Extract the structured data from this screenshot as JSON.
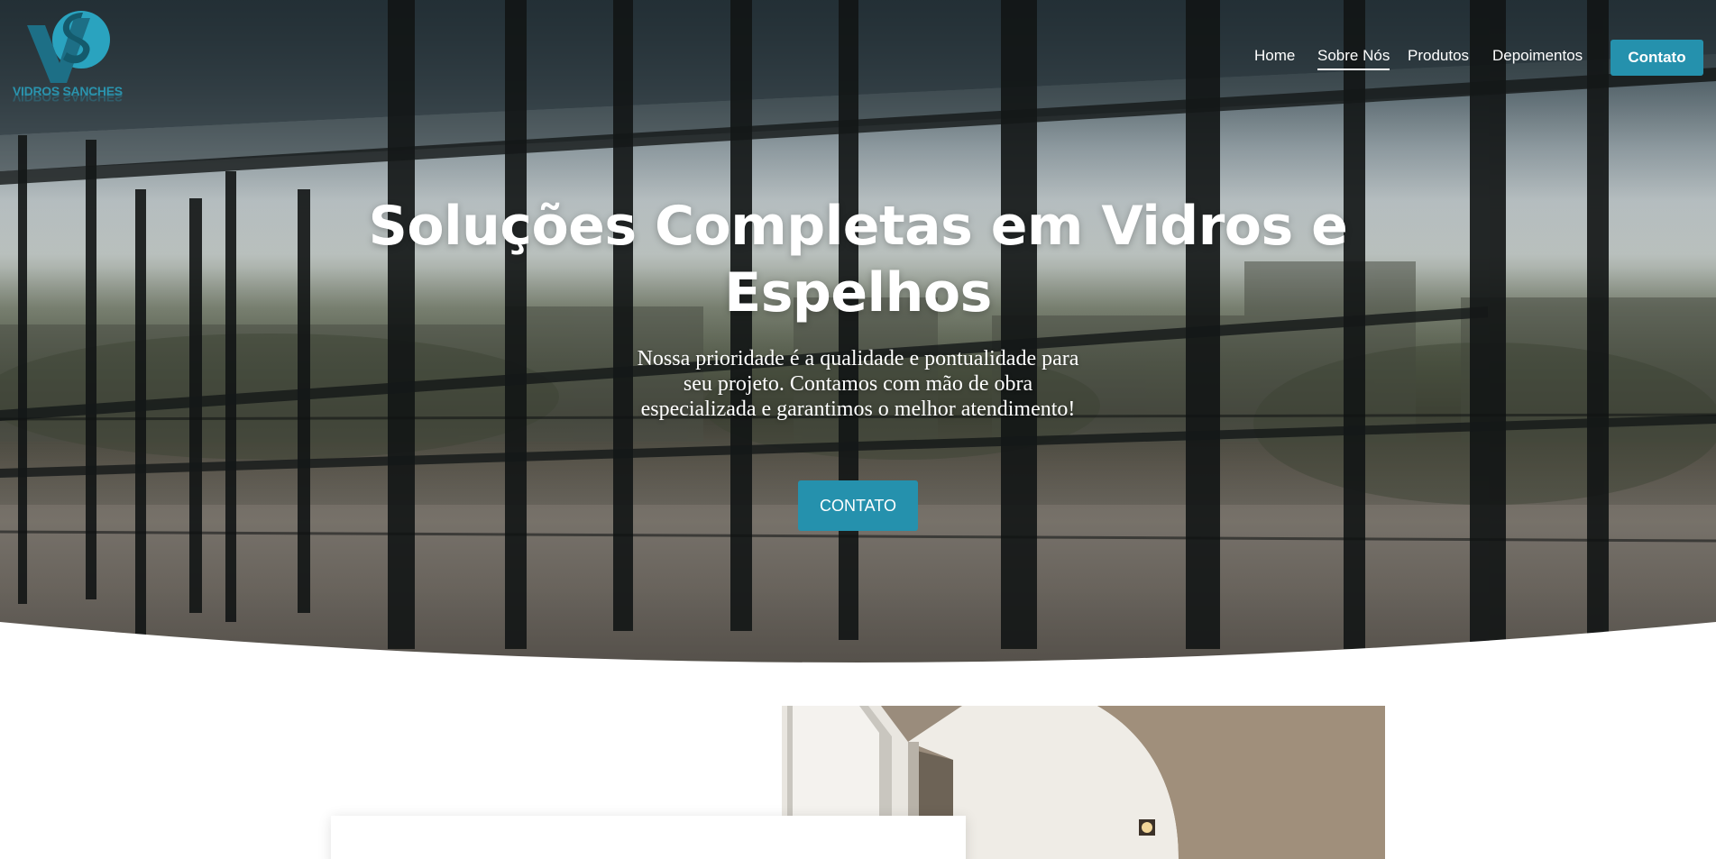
{
  "brand": {
    "name": "VIDROS SANCHES",
    "logo_icon": "vs-monogram-logo",
    "accent_color": "#2591ad"
  },
  "nav": {
    "items": [
      {
        "label": "Home"
      },
      {
        "label": "Sobre Nós",
        "active": true
      },
      {
        "label": "Produtos"
      },
      {
        "label": "Depoimentos"
      }
    ],
    "cta_label": "Contato"
  },
  "hero": {
    "title": "Soluções Completas em Vidros e Espelhos",
    "subtitle": "Nossa prioridade é a qualidade e pontualidade para seu projeto. Contamos com mão de obra especializada e garantimos o melhor atendimento!",
    "cta_label": "CONTATO"
  }
}
